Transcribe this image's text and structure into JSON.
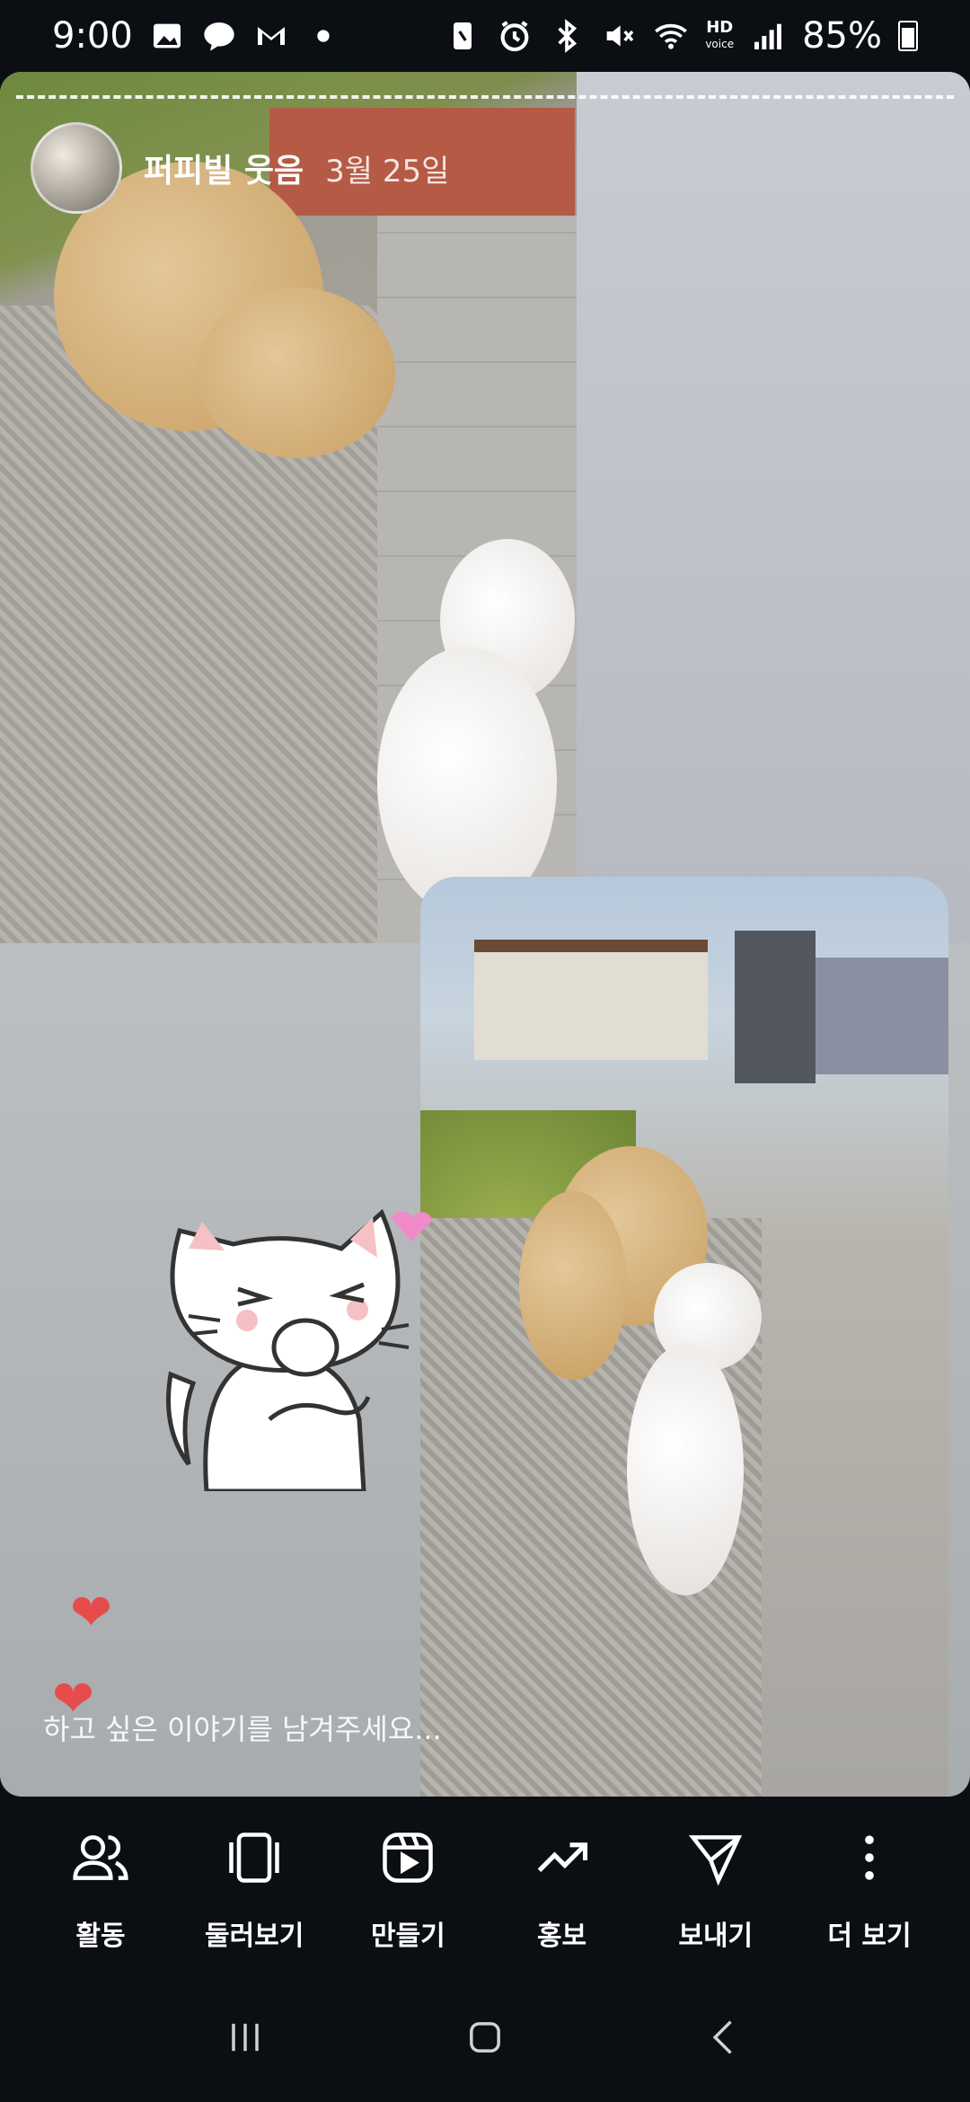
{
  "status_bar": {
    "time": "9:00",
    "battery": "85%",
    "hd_label": "HD",
    "voice_label": "voice",
    "icons_left": [
      "gallery-icon",
      "kakaotalk-icon",
      "gmail-icon",
      "dot-icon"
    ],
    "icons_right": [
      "nfc-icon",
      "alarm-icon",
      "bluetooth-icon",
      "mute-icon",
      "wifi-icon",
      "signal-icon",
      "battery-icon"
    ]
  },
  "story": {
    "username": "퍼피빌 웃음",
    "date": "3월 25일",
    "reply_placeholder": "하고 싶은 이야기를 남겨주세요..."
  },
  "actions": [
    {
      "label": "활동",
      "icon": "people-icon"
    },
    {
      "label": "둘러보기",
      "icon": "carousel-icon"
    },
    {
      "label": "만들기",
      "icon": "reel-create-icon"
    },
    {
      "label": "홍보",
      "icon": "trend-up-icon"
    },
    {
      "label": "보내기",
      "icon": "send-icon"
    },
    {
      "label": "더 보기",
      "icon": "more-vertical-icon"
    }
  ],
  "nav": [
    "recents-icon",
    "home-icon",
    "back-icon"
  ],
  "colors": {
    "heart": "#e74c4c",
    "background": "#0b0f14"
  }
}
